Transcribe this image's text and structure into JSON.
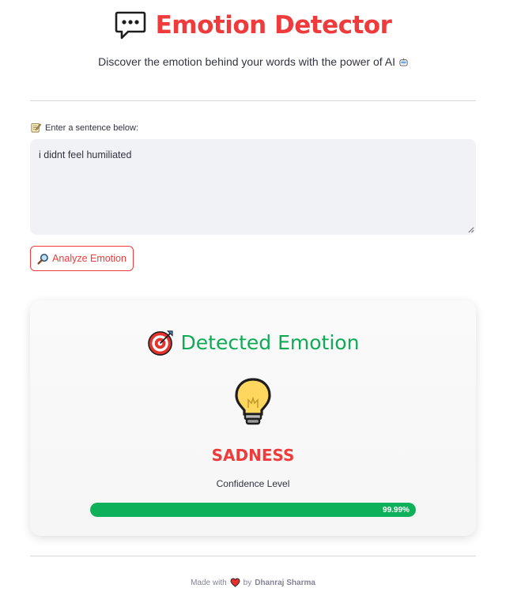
{
  "header": {
    "title": "Emotion Detector",
    "subtitle": "Discover the emotion behind your words with the power of AI",
    "title_icon": "speech-bubble-icon",
    "subtitle_icon": "robot-face-icon"
  },
  "input": {
    "label": "Enter a sentence below:",
    "label_icon": "memo-icon",
    "value": "i didnt feel humiliated"
  },
  "analyze_button": {
    "label": "Analyze Emotion",
    "icon": "magnifier-icon"
  },
  "result": {
    "heading": "Detected Emotion",
    "heading_icon": "target-icon",
    "emotion_icon": "light-bulb-icon",
    "emotion": "SADNESS",
    "confidence_label": "Confidence Level",
    "confidence_percent": 99.99,
    "confidence_text": "99.99%"
  },
  "footer": {
    "made_with": "Made with",
    "by": "by",
    "author": "Dhanraj Sharma",
    "icon": "heart-icon"
  },
  "colors": {
    "accent_red": "#ef3b3b",
    "success_green": "#0faa55",
    "progress_green": "#0fb05a",
    "input_bg": "#f0f2f6"
  }
}
